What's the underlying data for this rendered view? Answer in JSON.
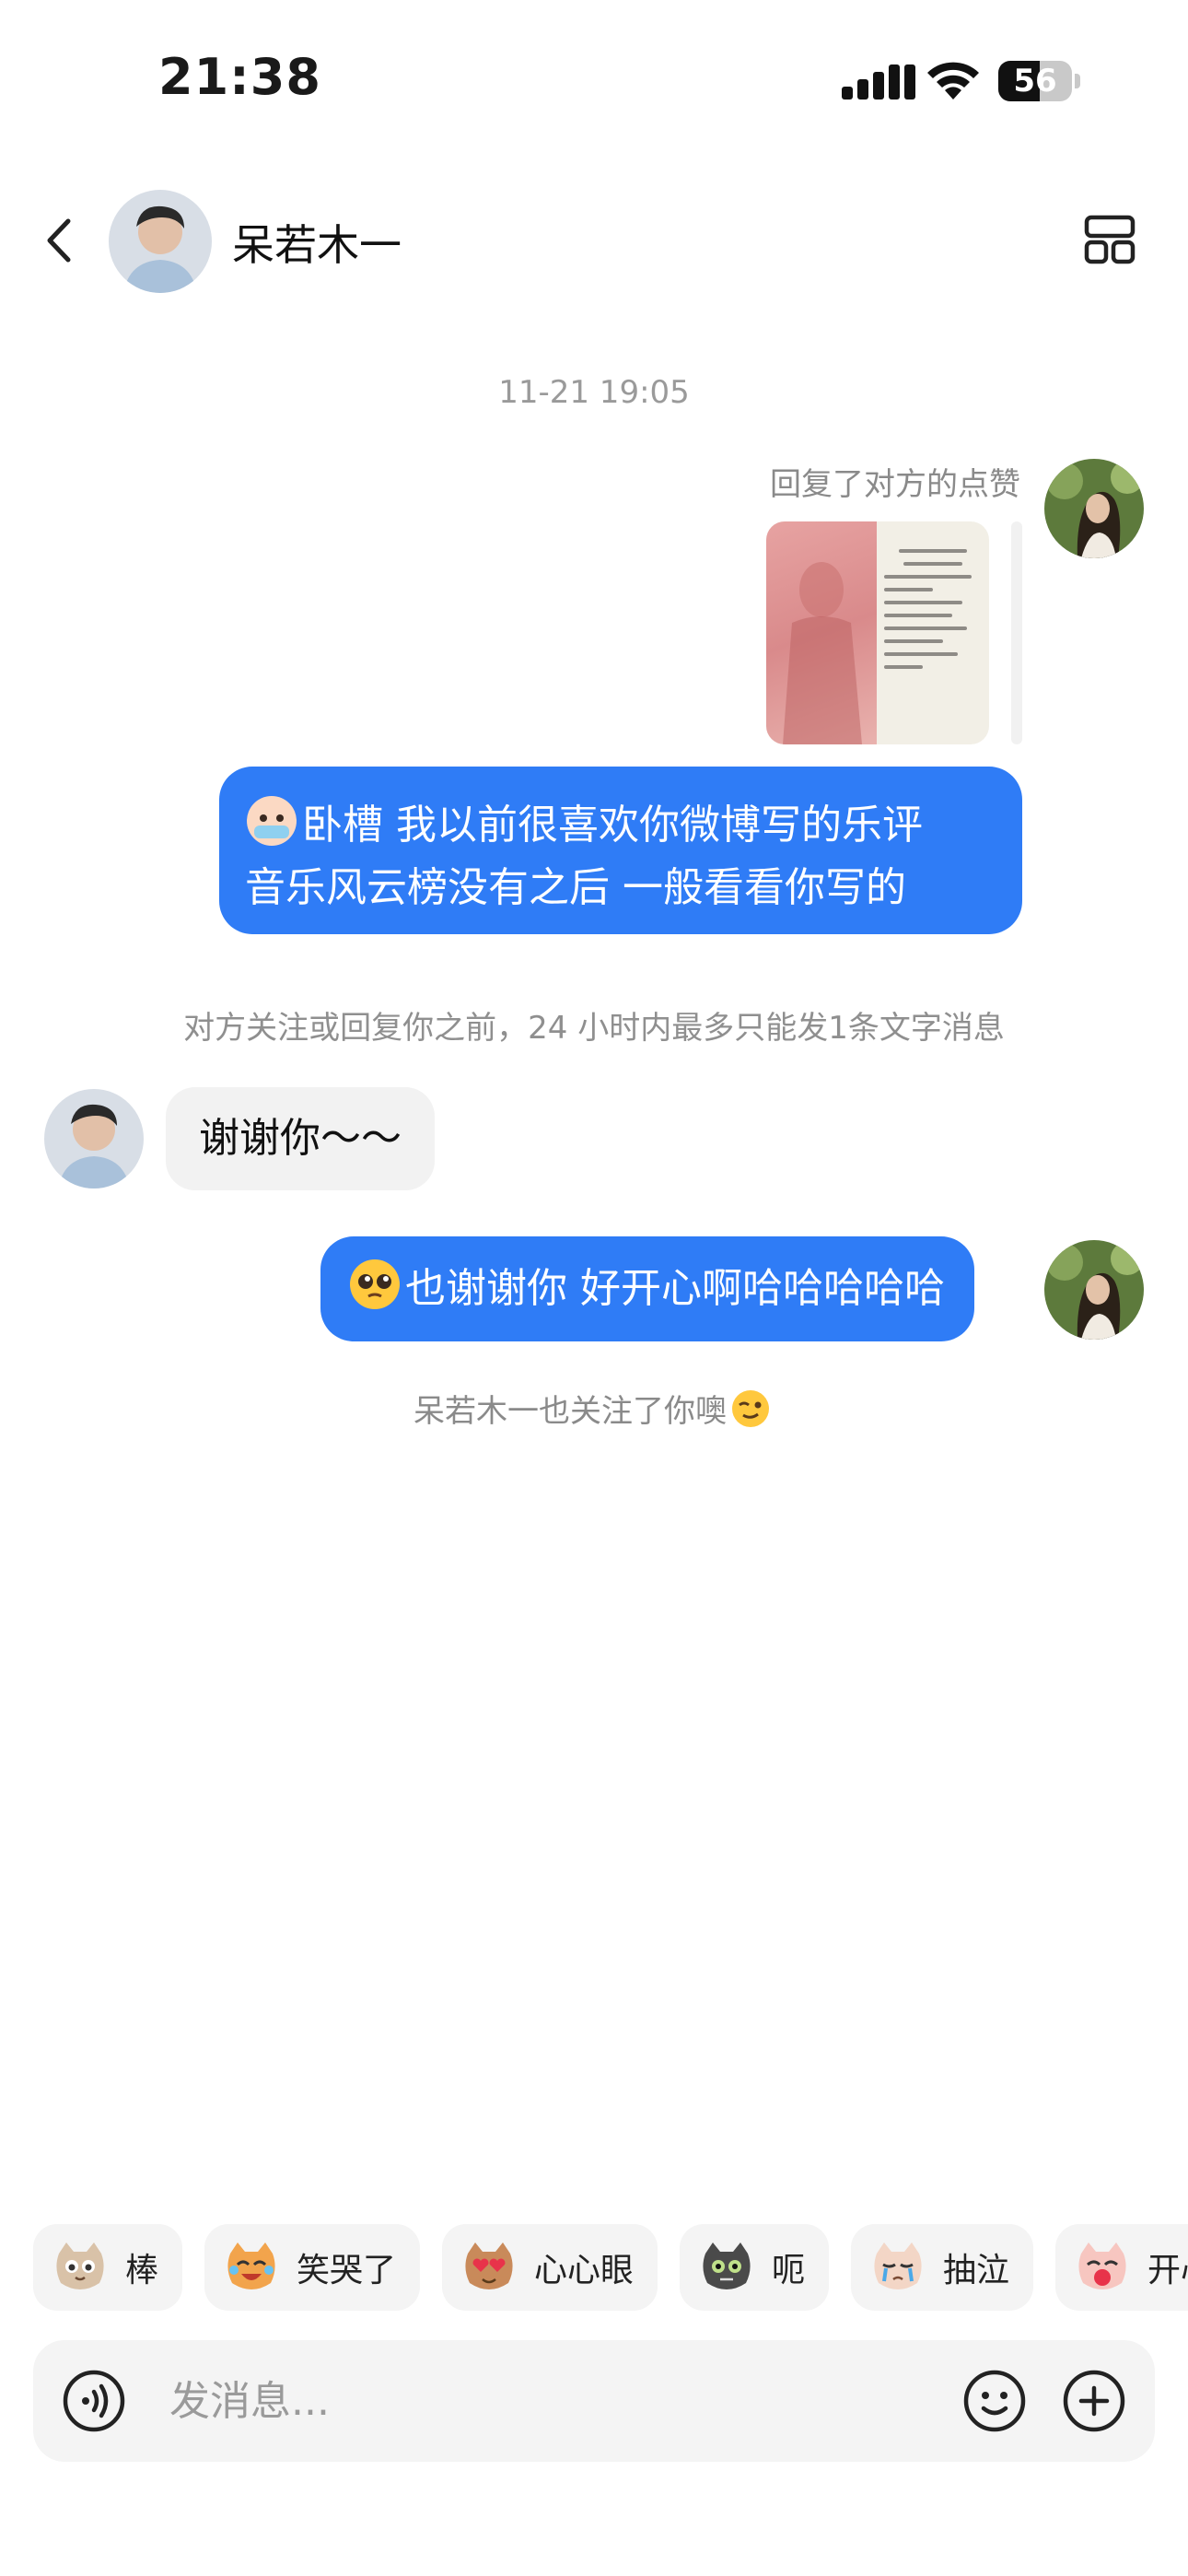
{
  "status_bar": {
    "time": "21:38",
    "battery": "56",
    "battery_level": 0.56
  },
  "header": {
    "contact_name": "呆若木一"
  },
  "chat": {
    "timestamp": "11-21 19:05",
    "reply_note": "回复了对方的点赞",
    "message_1_line_1": "卧槽 我以前很喜欢你微博写的乐评",
    "message_1_line_2": "音乐风云榜没有之后 一般看看你写的",
    "limit_notice": "对方关注或回复你之前，24 小时内最多只能发1条文字消息",
    "reply_message": "谢谢你～～",
    "message_2": "也谢谢你 好开心啊哈哈哈哈哈",
    "follow_notice": "呆若木一也关注了你噢"
  },
  "stickers": [
    {
      "label": "棒",
      "icon": "cat-thumbs-icon"
    },
    {
      "label": "笑哭了",
      "icon": "cat-laugh-cry-icon"
    },
    {
      "label": "心心眼",
      "icon": "cat-heart-eyes-icon"
    },
    {
      "label": "呃",
      "icon": "cat-awkward-icon"
    },
    {
      "label": "抽泣",
      "icon": "cat-sob-icon"
    },
    {
      "label": "开心",
      "icon": "cat-happy-icon"
    }
  ],
  "input": {
    "placeholder": "发消息..."
  },
  "colors": {
    "bubble_blue": "#2f7cf6",
    "bubble_gray": "#f2f2f2",
    "background": "#ffffff"
  }
}
